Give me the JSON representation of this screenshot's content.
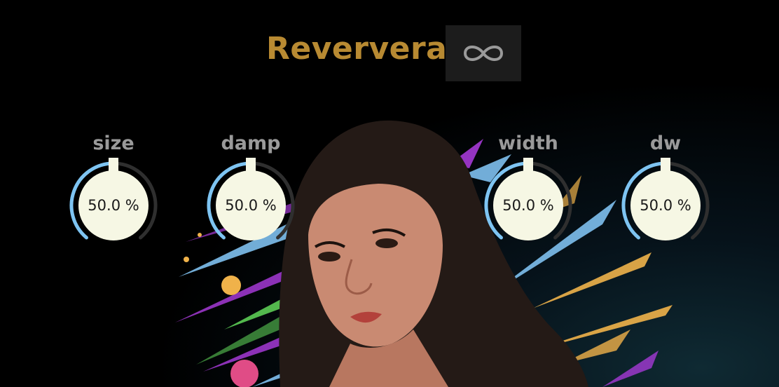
{
  "plugin": {
    "title": "Reververa",
    "loop_icon": "infinity-icon"
  },
  "colors": {
    "title": "#b88a32",
    "arc_active": "#7ec4f2",
    "arc_inactive": "#2f2f2f",
    "knob_face": "#f6f7e4",
    "label": "#9a9a9a",
    "button_bg": "#1c1c1c"
  },
  "knobs": [
    {
      "label": "size",
      "value_text": "50.0 %",
      "value": 0.5
    },
    {
      "label": "damp",
      "value_text": "50.0 %",
      "value": 0.5
    },
    {
      "label": "width",
      "value_text": "50.0 %",
      "value": 0.5
    },
    {
      "label": "dw",
      "value_text": "50.0 %",
      "value": 0.5
    }
  ]
}
